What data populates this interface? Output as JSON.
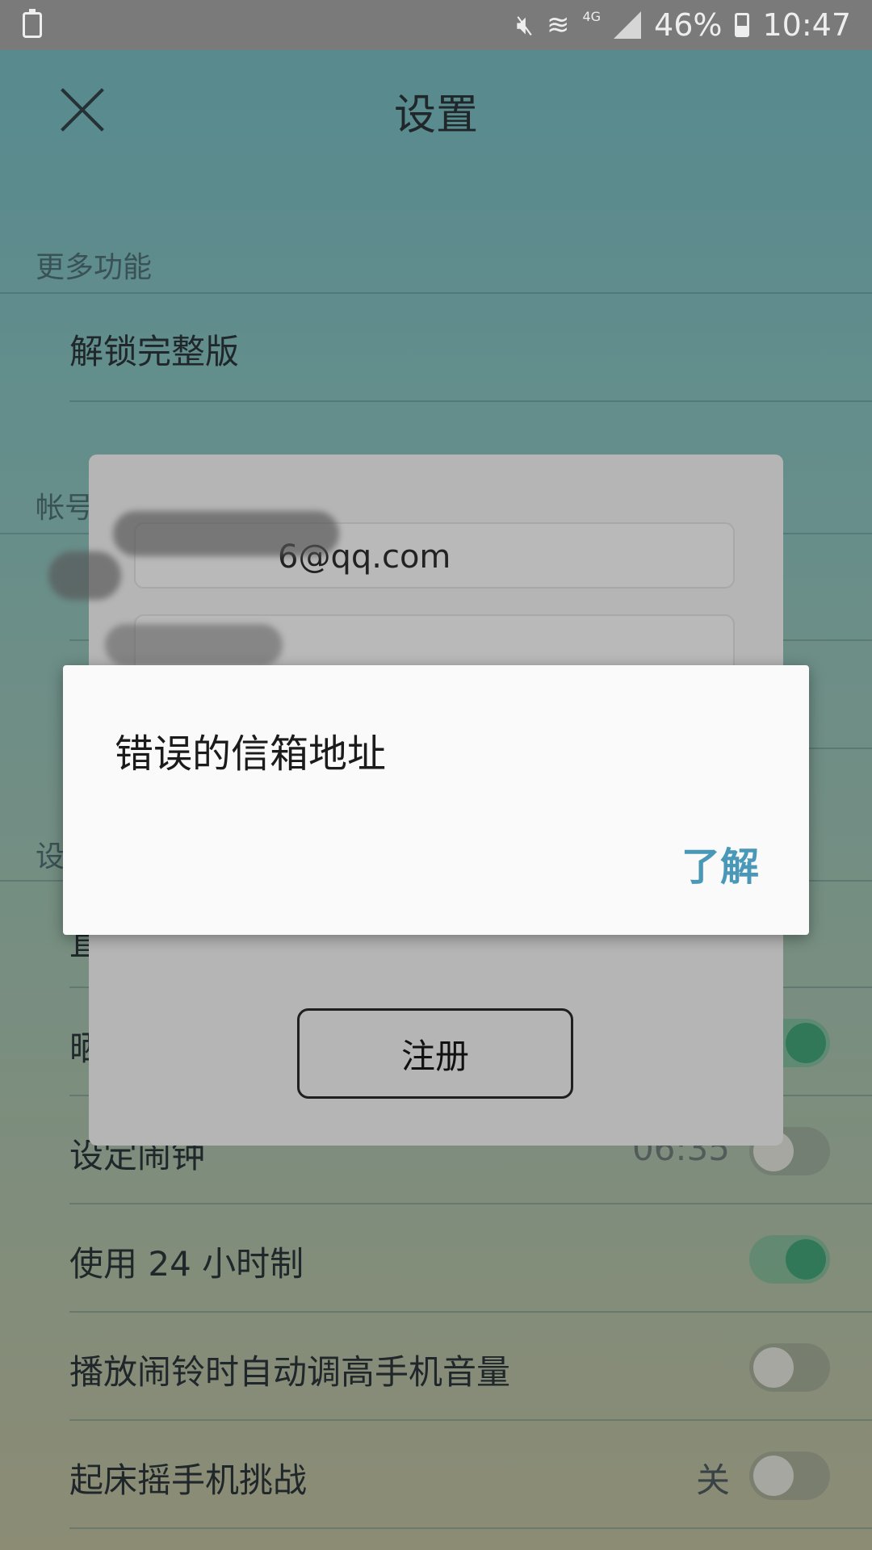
{
  "status_bar": {
    "left_icon": "recycle-battery-icon",
    "icons": [
      "mute-icon",
      "wifi-icon",
      "signal-icon",
      "battery-icon"
    ],
    "network": "4G",
    "battery_percent": "46%",
    "time": "10:47"
  },
  "header": {
    "title": "设置",
    "close_icon": "close-icon"
  },
  "sections": {
    "more_features": "更多功能",
    "account": "帐号",
    "settings": "设"
  },
  "rows": {
    "unlock_full": "解锁完整版",
    "alarm_label": "设定闹钟",
    "alarm_time": "06:35",
    "use_24h": "使用 24 小时制",
    "auto_volume": "播放闹铃时自动调高手机音量",
    "shake_challenge": "起床摇手机挑战",
    "shake_value": "关",
    "partial_row_1": "直",
    "partial_row_2": "晒"
  },
  "toggles": {
    "row_partial": true,
    "alarm": false,
    "use_24h": true,
    "auto_volume": false,
    "shake_challenge": false
  },
  "registration": {
    "email_visible": "6@qq.com",
    "register_label": "注册"
  },
  "dialog": {
    "message": "错误的信箱地址",
    "ok_label": "了解"
  },
  "colors": {
    "accent_link": "#4a98b8",
    "toggle_on": "#3f9a72"
  }
}
